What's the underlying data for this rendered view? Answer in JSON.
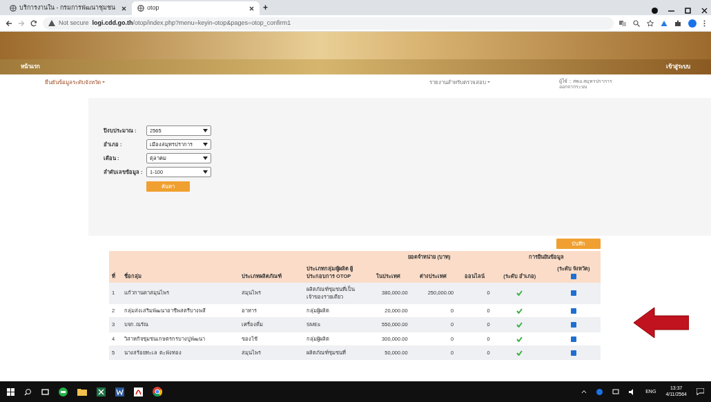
{
  "browser": {
    "tabs": [
      {
        "title": "บริการงานใน - กรมการพัฒนาชุมชน",
        "selected": false
      },
      {
        "title": "otop",
        "selected": true
      }
    ],
    "new_tab": "+",
    "security": "Not secure",
    "url_host": "logi.cdd.go.th",
    "url_path": "/otop/index.php?menu=keyin-otop&pages=otop_confirm1"
  },
  "navbar": {
    "home": "หน้าแรก",
    "login": "เข้าสู่ระบบ"
  },
  "user_info": {
    "user": "ผู้ใช้ :: สพอ.สมุทรปราการ",
    "logout": "ออกจากระบบ"
  },
  "menu": [
    "ยืนยันข้อมูลระดับจังหวัด",
    "รายงานสำหรับตรวจสอบ"
  ],
  "filters": [
    {
      "label": "ปีงบประมาณ :",
      "value": "2565"
    },
    {
      "label": "อำเภอ :",
      "value": "เมืองสมุทรปราการ"
    },
    {
      "label": "เดือน :",
      "value": "ตุลาคม"
    },
    {
      "label": "ลำดับเลขข้อมูล :",
      "value": "1-100"
    }
  ],
  "search_button": "ค้นหา",
  "save_button": "บันทึก",
  "table": {
    "sales_group": "ยอดจำหน่าย (บาท)",
    "confirm_group": "การยืนยันข้อมูล",
    "columns": [
      "ที่",
      "ชื่อกลุ่ม",
      "ประเภทผลิตภัณฑ์",
      "ประเภทกลุ่ม/ผู้ผลิต ผู้ประกอบการ OTOP",
      "ในประเทศ",
      "ต่างประเทศ",
      "ออนไลน์",
      "(ระดับ อำเภอ)",
      "(ระดับ จังหวัด)"
    ],
    "select_all_checked": true,
    "rows": [
      {
        "no": "1",
        "group": "แก้วกานดาสมุนไพร",
        "product_type": "สมุนไพร",
        "producer_type": "ผลิตภัณฑ์ชุมชนที่เป็นเจ้าของรายเดียว",
        "domestic": "380,000.00",
        "foreign": "250,000.00",
        "online": "0",
        "district_confirmed": true,
        "province_checked": true
      },
      {
        "no": "2",
        "group": "กลุ่มส่งเสริมพัฒนาอาชีพสตรีบางพลี",
        "product_type": "อาหาร",
        "producer_type": "กลุ่มผู้ผลิต",
        "domestic": "20,000.00",
        "foreign": "0",
        "online": "0",
        "district_confirmed": true,
        "province_checked": true
      },
      {
        "no": "3",
        "group": "บจก.ณรัณ",
        "product_type": "เครื่องดื่ม",
        "producer_type": "SMEs",
        "domestic": "550,000.00",
        "foreign": "0",
        "online": "0",
        "district_confirmed": true,
        "province_checked": true
      },
      {
        "no": "4",
        "group": "วิสาหกิจชุมชนเกษตรกรบางปูพัฒนา",
        "product_type": "ของใช้",
        "producer_type": "กลุ่มผู้ผลิต",
        "domestic": "300,000.00",
        "foreign": "0",
        "online": "0",
        "district_confirmed": true,
        "province_checked": true
      },
      {
        "no": "5",
        "group": "นางสร้อยทะเล ตะพังทอง",
        "product_type": "สมุนไพร",
        "producer_type": "ผลิตภัณฑ์ชุมชนที่",
        "domestic": "50,000.00",
        "foreign": "0",
        "online": "0",
        "district_confirmed": true,
        "province_checked": true
      }
    ]
  },
  "taskbar": {
    "lang": "ENG",
    "time": "13:37",
    "date": "4/11/2564"
  }
}
